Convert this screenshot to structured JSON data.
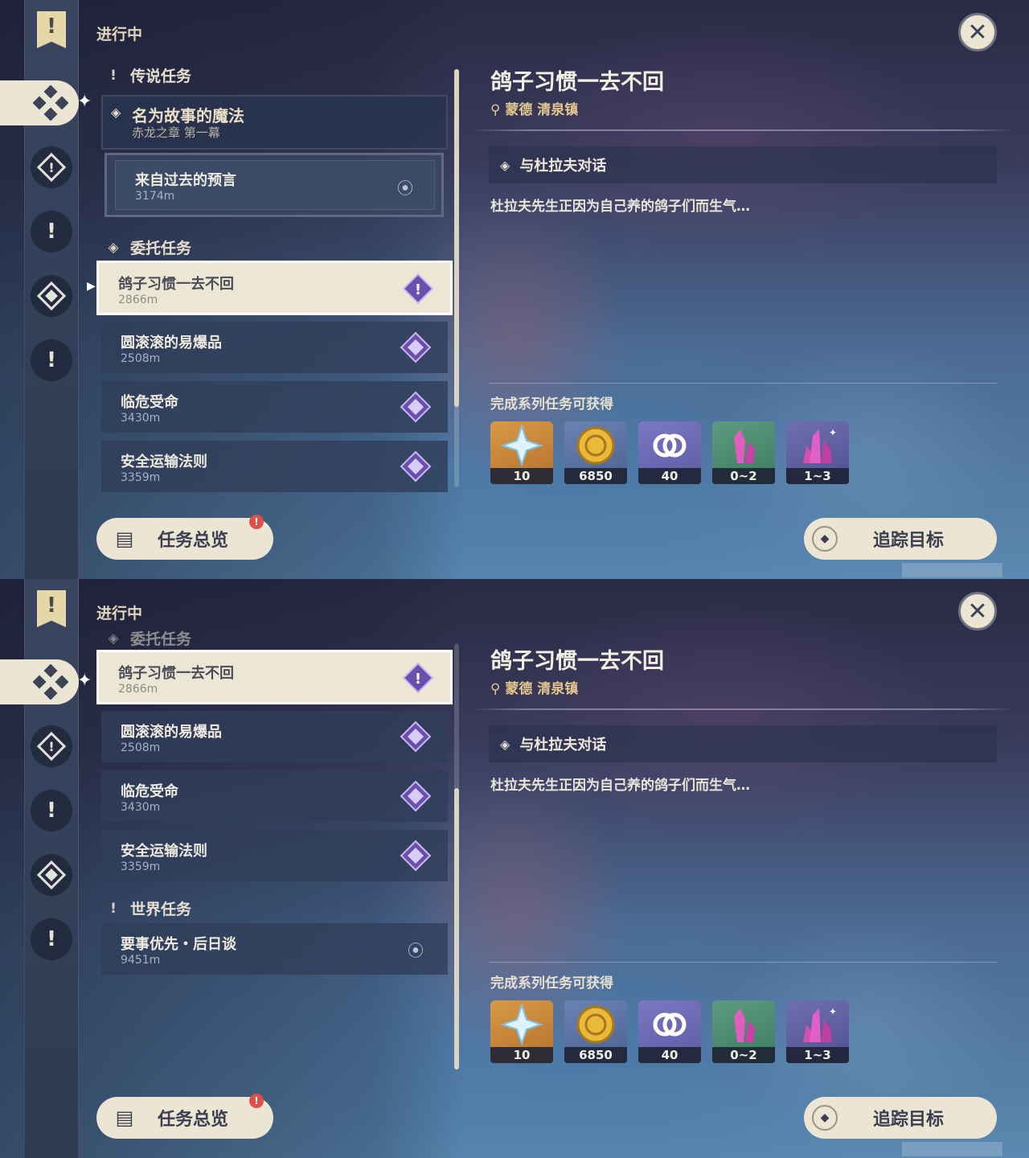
{
  "sidebar": {
    "items": [
      {
        "icon": "quest-banner-icon"
      },
      {
        "icon": "commission-icon"
      },
      {
        "icon": "story-quest-icon"
      },
      {
        "icon": "legend-quest-icon"
      },
      {
        "icon": "daily-commission-icon"
      },
      {
        "icon": "world-quest-icon"
      }
    ]
  },
  "header": {
    "status": "进行中"
  },
  "sections": {
    "legend": "传说任务",
    "commission": "委托任务",
    "world": "世界任务"
  },
  "legend_quest": {
    "title": "名为故事的魔法",
    "subtitle": "赤龙之章 第一幕",
    "step_name": "来自过去的预言",
    "step_dist": "3174m"
  },
  "quests": [
    {
      "name": "鸽子习惯一去不回",
      "dist": "2866m"
    },
    {
      "name": "圆滚滚的易爆品",
      "dist": "2508m"
    },
    {
      "name": "临危受命",
      "dist": "3430m"
    },
    {
      "name": "安全运输法则",
      "dist": "3359m"
    }
  ],
  "world_quest": {
    "name": "要事优先・后日谈",
    "dist": "9451m"
  },
  "detail": {
    "title": "鸽子习惯一去不回",
    "location": "蒙德 清泉镇",
    "objective": "与杜拉夫对话",
    "description": "杜拉夫先生正因为自己养的鸽子们而生气…",
    "rewards_title": "完成系列任务可获得",
    "rewards": [
      {
        "name": "primogem",
        "count": "10"
      },
      {
        "name": "mora",
        "count": "6850"
      },
      {
        "name": "adventure-exp",
        "count": "40"
      },
      {
        "name": "crystal-chunk",
        "count": "0~2"
      },
      {
        "name": "crystal-cluster",
        "count": "1~3"
      }
    ]
  },
  "buttons": {
    "overview": "任务总览",
    "overview_badge": "!",
    "track": "追踪目标"
  }
}
